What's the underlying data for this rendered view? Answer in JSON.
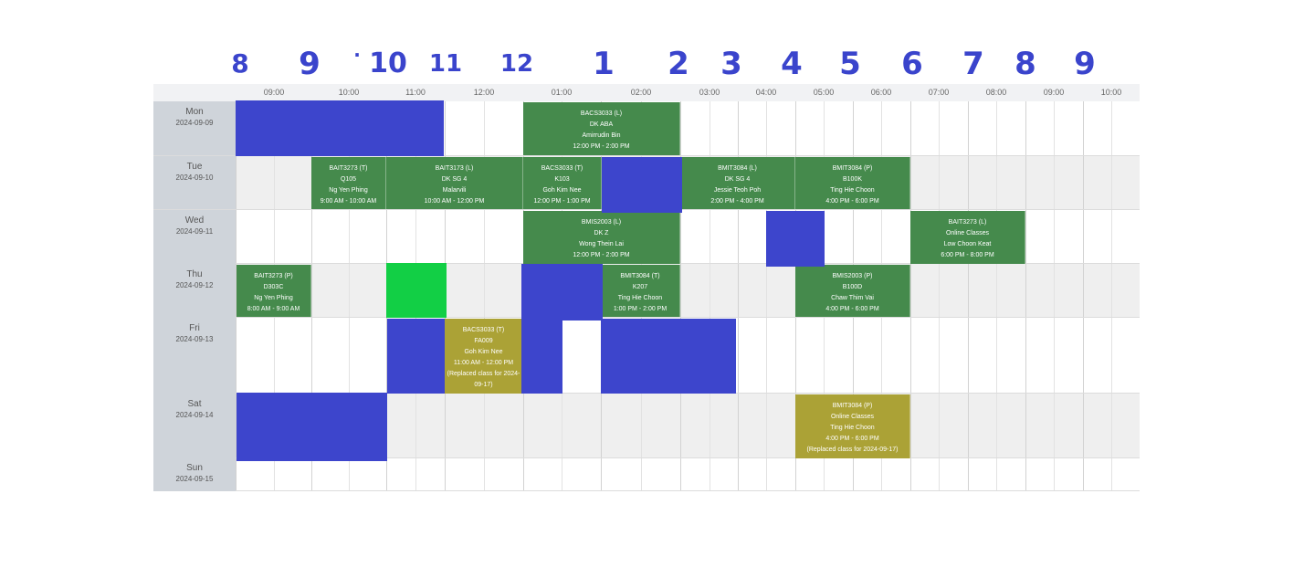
{
  "handwriting": [
    "8",
    "9",
    "·",
    "10",
    "11",
    "12",
    "1",
    "2",
    "3",
    "4",
    "5",
    "6",
    "7",
    "8",
    "9"
  ],
  "time_headers": [
    "09:00",
    "10:00",
    "11:00",
    "12:00",
    "01:00",
    "02:00",
    "03:00",
    "04:00",
    "05:00",
    "06:00",
    "07:00",
    "08:00",
    "09:00",
    "10:00"
  ],
  "days": [
    {
      "name": "Mon",
      "date": "2024-09-09"
    },
    {
      "name": "Tue",
      "date": "2024-09-10"
    },
    {
      "name": "Wed",
      "date": "2024-09-11"
    },
    {
      "name": "Thu",
      "date": "2024-09-12"
    },
    {
      "name": "Fri",
      "date": "2024-09-13"
    },
    {
      "name": "Sat",
      "date": "2024-09-14"
    },
    {
      "name": "Sun",
      "date": "2024-09-15"
    }
  ],
  "events": [
    {
      "code": "BACS3033 (L)",
      "room": "DK ABA",
      "lecturer": "Amirrudin Bin",
      "time": "12:00 PM - 2:00 PM",
      "note": "",
      "color": "#458a4c"
    },
    {
      "code": "BAIT3273 (T)",
      "room": "Q105",
      "lecturer": "Ng Yen Phing",
      "time": "9:00 AM - 10:00 AM",
      "note": "",
      "color": "#458a4c"
    },
    {
      "code": "BAIT3173 (L)",
      "room": "DK SG 4",
      "lecturer": "Malarvili",
      "time": "10:00 AM - 12:00 PM",
      "note": "",
      "color": "#458a4c"
    },
    {
      "code": "BACS3033 (T)",
      "room": "K103",
      "lecturer": "Goh Kim Nee",
      "time": "12:00 PM - 1:00 PM",
      "note": "",
      "color": "#458a4c"
    },
    {
      "code": "BMIT3084 (L)",
      "room": "DK SG 4",
      "lecturer": "Jessie Teoh Poh",
      "time": "2:00 PM - 4:00 PM",
      "note": "",
      "color": "#458a4c"
    },
    {
      "code": "BMIT3084 (P)",
      "room": "B100K",
      "lecturer": "Ting Hie Choon",
      "time": "4:00 PM - 6:00 PM",
      "note": "",
      "color": "#458a4c"
    },
    {
      "code": "BMIS2003 (L)",
      "room": "DK Z",
      "lecturer": "Wong Thein Lai",
      "time": "12:00 PM - 2:00 PM",
      "note": "",
      "color": "#458a4c"
    },
    {
      "code": "BAIT3273 (L)",
      "room": "Online Classes",
      "lecturer": "Low Choon Keat",
      "time": "6:00 PM - 8:00 PM",
      "note": "",
      "color": "#458a4c"
    },
    {
      "code": "BAIT3273 (P)",
      "room": "D303C",
      "lecturer": "Ng Yen Phing",
      "time": "8:00 AM - 9:00 AM",
      "note": "",
      "color": "#458a4c"
    },
    {
      "code": "BMIT3084 (T)",
      "room": "K207",
      "lecturer": "Ting Hie Choon",
      "time": "1:00 PM - 2:00 PM",
      "note": "",
      "color": "#458a4c"
    },
    {
      "code": "BMIS2003 (P)",
      "room": "B100D",
      "lecturer": "Chaw Thim Vai",
      "time": "4:00 PM - 6:00 PM",
      "note": "",
      "color": "#458a4c"
    },
    {
      "code": "BACS3033 (T)",
      "room": "FA009",
      "lecturer": "Goh Kim Nee",
      "time": "11:00 AM - 12:00 PM",
      "note": "(Replaced class for 2024-09-17)",
      "color": "#aba236"
    },
    {
      "code": "BMIT3084 (P)",
      "room": "Online Classes",
      "lecturer": "Ting Hie Choon",
      "time": "4:00 PM - 6:00 PM",
      "note": "(Replaced class for 2024-09-17)",
      "color": "#aba236"
    }
  ],
  "colors": {
    "blue_overlay": "#3d45cc",
    "green_overlay": "#12cf45",
    "class_green": "#458a4c",
    "class_replaced": "#aba236",
    "day_column": "#cfd4da"
  }
}
